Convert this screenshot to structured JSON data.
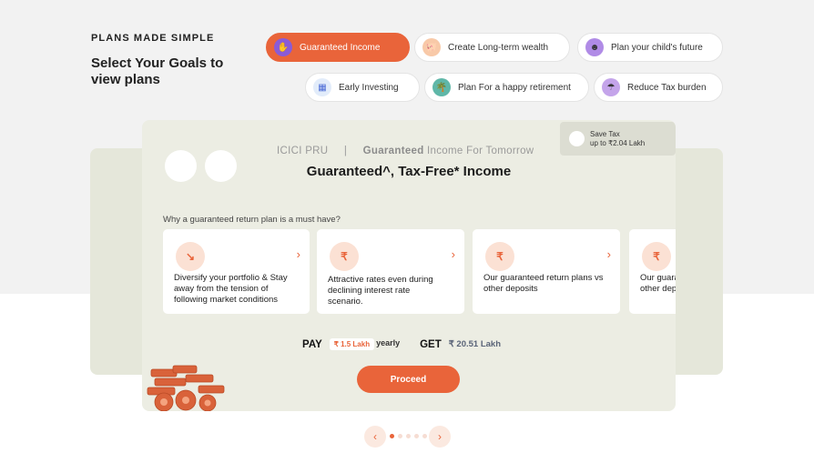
{
  "colors": {
    "accent": "#e9643a",
    "top_bg": "#f2f2f2",
    "card": "#ecede3"
  },
  "heading": {
    "eyebrow": "PLANS MADE SIMPLE",
    "title": "Select Your Goals to view plans"
  },
  "goals": [
    {
      "label": "Guaranteed Income",
      "icon": "hand-coins-icon",
      "active": true
    },
    {
      "label": "Create Long-term wealth",
      "icon": "piggy-bank-icon",
      "active": false
    },
    {
      "label": "Plan your child's future",
      "icon": "child-icon",
      "active": false
    },
    {
      "label": "Early Investing",
      "icon": "calculator-icon",
      "active": false
    },
    {
      "label": "Plan For a happy retirement",
      "icon": "beach-icon",
      "active": false
    },
    {
      "label": "Reduce Tax burden",
      "icon": "umbrella-icon",
      "active": false
    }
  ],
  "card": {
    "brand": "ICICI PRU",
    "separator": "|",
    "tag_bold": "Guaranteed",
    "tag_rest": " Income For Tomorrow",
    "title": "Guaranteed^, Tax-Free* Income",
    "savetax": {
      "line1": "Save Tax",
      "line2": "up to ₹2.04 Lakh"
    },
    "why": "Why a guaranteed return plan is a must have?",
    "benefits": [
      {
        "text": "Diversify your portfolio & Stay away from the tension of following market conditions",
        "icon": "trend-down-icon"
      },
      {
        "text": "Attractive rates even during declining interest rate scenario.",
        "icon": "rupee-badge-icon"
      },
      {
        "text": "Our guaranteed return plans vs other deposits",
        "icon": "rupee-badge-icon"
      },
      {
        "text": "Our guaranteed return plans vs other deposits",
        "icon": "rupee-badge-icon"
      }
    ],
    "pay_label": "PAY",
    "pay_amount": "₹ 1.5 Lakh",
    "pay_period": "yearly",
    "get_label": "GET",
    "get_amount": "₹ 20.51 Lakh",
    "proceed": "Proceed"
  },
  "carousel": {
    "prev": "‹",
    "next": "›",
    "total": 5,
    "current": 1
  }
}
